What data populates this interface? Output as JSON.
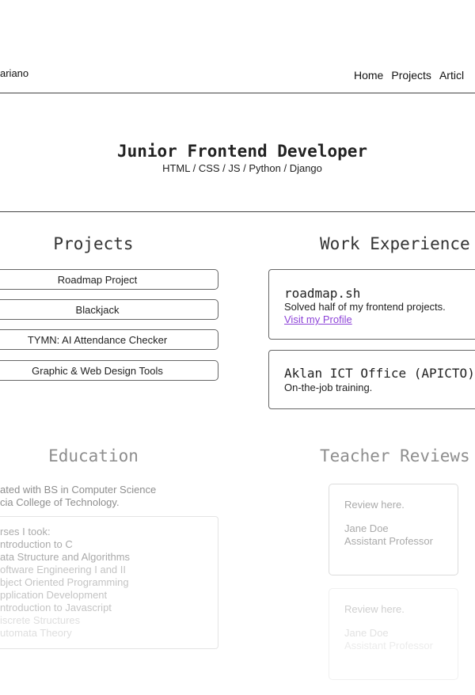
{
  "header": {
    "brand": "ariano",
    "nav": [
      "Home",
      "Projects",
      "Articl"
    ]
  },
  "hero": {
    "title": "Junior Frontend Developer",
    "subtitle": "HTML / CSS / JS / Python / Django"
  },
  "projects": {
    "heading": "Projects",
    "items": [
      "Roadmap Project",
      "Blackjack",
      "TYMN: AI Attendance Checker",
      "Graphic & Web Design Tools"
    ]
  },
  "work": {
    "heading": "Work Experience",
    "items": [
      {
        "title": "roadmap.sh",
        "text": "Solved half of my frontend projects.",
        "link": "Visit my Profile"
      },
      {
        "title": "Aklan ICT Office (APICTO)",
        "text": "On-the-job training."
      }
    ]
  },
  "education": {
    "heading": "Education",
    "lines": [
      "ated with BS in Computer Science",
      "cia College of Technology."
    ],
    "courses_label": "rses I took:",
    "courses": [
      "ntroduction to C",
      "ata Structure and Algorithms",
      "oftware Engineering I and II",
      "bject Oriented Programming",
      "pplication Development",
      "ntroduction to Javascript",
      "iscrete Structures",
      "utomata Theory"
    ]
  },
  "reviews": {
    "heading": "Teacher Reviews",
    "items": [
      {
        "text": "Review here.",
        "name": "Jane Doe",
        "role": "Assistant Professor"
      },
      {
        "text": "Review here.",
        "name": "Jane Doe",
        "role": "Assistant Professor"
      }
    ]
  },
  "colors": {
    "link": "#8e44d8",
    "border": "#666666"
  }
}
